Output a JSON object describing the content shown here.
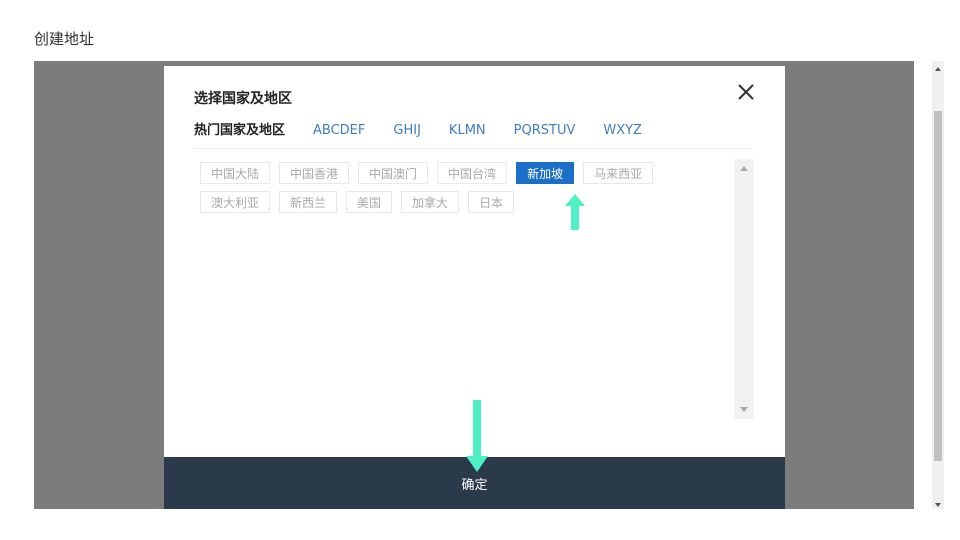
{
  "page": {
    "title": "创建地址"
  },
  "modal": {
    "title": "选择国家及地区",
    "close_icon": "close-icon",
    "tabs": [
      {
        "label": "热门国家及地区",
        "active": true
      },
      {
        "label": "ABCDEF",
        "active": false
      },
      {
        "label": "GHIJ",
        "active": false
      },
      {
        "label": "KLMN",
        "active": false
      },
      {
        "label": "PQRSTUV",
        "active": false
      },
      {
        "label": "WXYZ",
        "active": false
      }
    ],
    "regions_row1": [
      {
        "label": "中国大陆"
      },
      {
        "label": "中国香港"
      },
      {
        "label": "中国澳门"
      },
      {
        "label": "中国台湾"
      },
      {
        "label": "新加坡",
        "selected": true
      },
      {
        "label": "马来西亚"
      }
    ],
    "regions_row2": [
      {
        "label": "澳大利亚"
      },
      {
        "label": "新西兰"
      },
      {
        "label": "美国"
      },
      {
        "label": "加拿大"
      },
      {
        "label": "日本"
      }
    ],
    "confirm_label": "确定"
  },
  "colors": {
    "accent": "#1b6fc6",
    "tab_link": "#3d7fc2",
    "confirm_bar": "#2b3a4b",
    "overlay": "#7c7c7c",
    "hint_arrow": "#4ef0c4"
  },
  "icons": {
    "hint_arrow_up": "arrow-up-icon",
    "hint_arrow_down": "arrow-down-icon"
  }
}
